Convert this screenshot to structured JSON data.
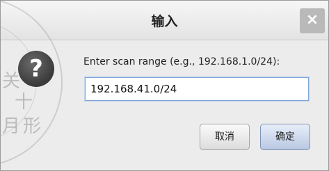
{
  "dialog": {
    "title": "输入",
    "close_icon": "close-icon",
    "prompt": "Enter scan range (e.g., 192.168.1.0/24):",
    "input_value": "192.168.41.0/24",
    "cancel_label": "取消",
    "ok_label": "确定",
    "icon": "question-icon"
  },
  "stamp": {
    "chars": [
      "关",
      "十",
      "月",
      "形"
    ]
  }
}
